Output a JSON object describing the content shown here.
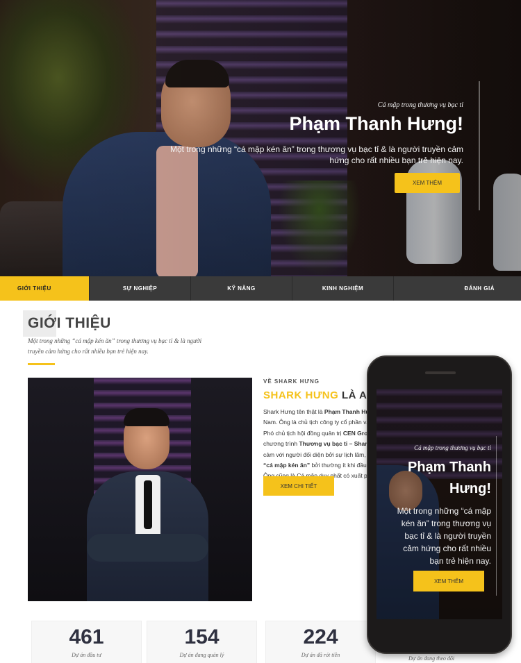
{
  "hero": {
    "subtitle": "Cá mập trong thương vụ bạc tỉ",
    "title": "Phạm Thanh Hưng!",
    "description": "Một trong những “cá mập kén ăn” trong thương vụ bạc tỉ & là người truyền cảm hứng cho rất nhiều bạn trẻ hiện nay.",
    "button_label": "XEM THÊM"
  },
  "tabs": [
    {
      "label": "GIỚI THIỆU",
      "active": true
    },
    {
      "label": "SỰ NGHIỆP",
      "active": false
    },
    {
      "label": "KỸ NĂNG",
      "active": false
    },
    {
      "label": "KINH NGHIỆM",
      "active": false
    },
    {
      "label": "ĐÁNH GIÁ",
      "active": false
    }
  ],
  "section": {
    "title": "GIỚI THIỆU",
    "description": "Một trong những “cá mập kén ăn” trong thương vụ bạc tỉ & là người truyền cảm hứng cho rất nhiều bạn trẻ hiện nay."
  },
  "about": {
    "label": "VỀ SHARK HƯNG",
    "title_highlight": "SHARK HƯNG",
    "title_rest": " LÀ AI?",
    "lines": [
      {
        "pre": "Shark Hưng tên thật là ",
        "bold": "Phạm Thanh Hưng",
        "post": ""
      },
      {
        "pre": "Nam. Ông là chủ tịch công ty cổ phần và Tập",
        "bold": "",
        "post": ""
      },
      {
        "pre": "Phó chủ tịch hội đồng quản trị ",
        "bold": "CEN Group",
        "post": ""
      },
      {
        "pre": "chương trình ",
        "bold": "Thương vụ bạc tỉ – Shark Tank",
        "post": ""
      },
      {
        "pre": "cảm với người đối diện bởi sự lịch lãm, tinh tế",
        "bold": "",
        "post": ""
      },
      {
        "pre": "",
        "bold": "“cá mập kén ăn”",
        "post": " bởi thường ít khi đầu tư"
      },
      {
        "pre": "Ông cũng là Cá mập duy nhất có xuất phát",
        "bold": "",
        "post": ""
      }
    ],
    "button_label": "XEM CHI TIẾT"
  },
  "stats": [
    {
      "number": "461",
      "label": "Dự án đầu tư"
    },
    {
      "number": "154",
      "label": "Dự án đang quản lý"
    },
    {
      "number": "224",
      "label": "Dự án đã rót tiền"
    },
    {
      "number": "",
      "label": "Dự án đang theo dõi"
    }
  ],
  "phone": {
    "subtitle": "Cá mập trong thương vụ bạc tỉ",
    "title": "Phạm Thanh Hưng!",
    "description": "Một trong những “cá mập kén ăn” trong thương vụ bạc tỉ & là người truyền cảm hứng cho rất nhiều bạn trẻ hiện nay.",
    "button_label": "XEM THÊM"
  }
}
